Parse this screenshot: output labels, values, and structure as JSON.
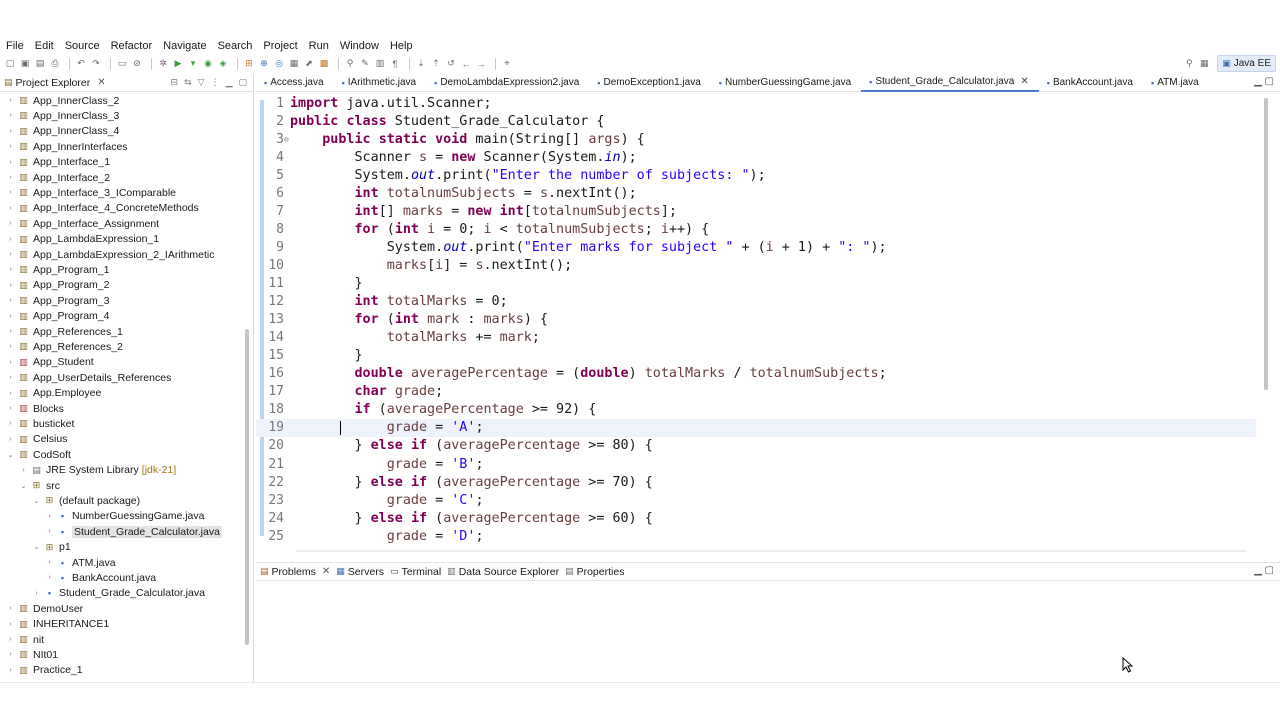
{
  "menu": [
    "File",
    "Edit",
    "Source",
    "Refactor",
    "Navigate",
    "Search",
    "Project",
    "Run",
    "Window",
    "Help"
  ],
  "perspective": {
    "label": "Java EE"
  },
  "project_explorer": {
    "title": "Project Explorer",
    "items": [
      {
        "label": "App_InnerClass_2",
        "level": 0,
        "expanded": false,
        "kind": "proj"
      },
      {
        "label": "App_InnerClass_3",
        "level": 0,
        "expanded": false,
        "kind": "proj"
      },
      {
        "label": "App_InnerClass_4",
        "level": 0,
        "expanded": false,
        "kind": "proj"
      },
      {
        "label": "App_InnerInterfaces",
        "level": 0,
        "expanded": false,
        "kind": "proj"
      },
      {
        "label": "App_Interface_1",
        "level": 0,
        "expanded": false,
        "kind": "proj"
      },
      {
        "label": "App_Interface_2",
        "level": 0,
        "expanded": false,
        "kind": "proj"
      },
      {
        "label": "App_Interface_3_IComparable",
        "level": 0,
        "expanded": false,
        "kind": "proj"
      },
      {
        "label": "App_Interface_4_ConcreteMethods",
        "level": 0,
        "expanded": false,
        "kind": "proj"
      },
      {
        "label": "App_Interface_Assignment",
        "level": 0,
        "expanded": false,
        "kind": "proj"
      },
      {
        "label": "App_LambdaExpression_1",
        "level": 0,
        "expanded": false,
        "kind": "proj"
      },
      {
        "label": "App_LambdaExpression_2_IArithmetic",
        "level": 0,
        "expanded": false,
        "kind": "proj"
      },
      {
        "label": "App_Program_1",
        "level": 0,
        "expanded": false,
        "kind": "proj"
      },
      {
        "label": "App_Program_2",
        "level": 0,
        "expanded": false,
        "kind": "proj"
      },
      {
        "label": "App_Program_3",
        "level": 0,
        "expanded": false,
        "kind": "proj"
      },
      {
        "label": "App_Program_4",
        "level": 0,
        "expanded": false,
        "kind": "proj"
      },
      {
        "label": "App_References_1",
        "level": 0,
        "expanded": false,
        "kind": "proj"
      },
      {
        "label": "App_References_2",
        "level": 0,
        "expanded": false,
        "kind": "proj"
      },
      {
        "label": "App_Student",
        "level": 0,
        "expanded": false,
        "kind": "jprj"
      },
      {
        "label": "App_UserDetails_References",
        "level": 0,
        "expanded": false,
        "kind": "proj"
      },
      {
        "label": "App.Employee",
        "level": 0,
        "expanded": false,
        "kind": "proj"
      },
      {
        "label": "Blocks",
        "level": 0,
        "expanded": false,
        "kind": "jprj"
      },
      {
        "label": "busticket",
        "level": 0,
        "expanded": false,
        "kind": "proj"
      },
      {
        "label": "Celsius",
        "level": 0,
        "expanded": false,
        "kind": "proj"
      },
      {
        "label": "CodSoft",
        "level": 0,
        "expanded": true,
        "kind": "proj"
      },
      {
        "label": "JRE System Library",
        "suffix": "[jdk-21]",
        "level": 1,
        "expanded": false,
        "kind": "lib"
      },
      {
        "label": "src",
        "level": 1,
        "expanded": true,
        "kind": "src"
      },
      {
        "label": "(default package)",
        "level": 2,
        "expanded": true,
        "kind": "pkg"
      },
      {
        "label": "NumberGuessingGame.java",
        "level": 3,
        "expanded": false,
        "kind": "java"
      },
      {
        "label": "Student_Grade_Calculator.java",
        "level": 3,
        "expanded": false,
        "kind": "java",
        "selected": true
      },
      {
        "label": "p1",
        "level": 2,
        "expanded": true,
        "kind": "pkg"
      },
      {
        "label": "ATM.java",
        "level": 3,
        "expanded": false,
        "kind": "java"
      },
      {
        "label": "BankAccount.java",
        "level": 3,
        "expanded": false,
        "kind": "java"
      },
      {
        "label": "Student_Grade_Calculator.java",
        "level": 2,
        "expanded": false,
        "kind": "java"
      },
      {
        "label": "DemoUser",
        "level": 0,
        "expanded": false,
        "kind": "proj"
      },
      {
        "label": "INHERITANCE1",
        "level": 0,
        "expanded": false,
        "kind": "proj"
      },
      {
        "label": "nit",
        "level": 0,
        "expanded": false,
        "kind": "proj"
      },
      {
        "label": "NIt01",
        "level": 0,
        "expanded": false,
        "kind": "proj"
      },
      {
        "label": "Practice_1",
        "level": 0,
        "expanded": false,
        "kind": "proj"
      }
    ]
  },
  "editor_tabs": [
    {
      "label": "Access.java",
      "active": false
    },
    {
      "label": "IArithmetic.java",
      "active": false
    },
    {
      "label": "DemoLambdaExpression2.java",
      "active": false
    },
    {
      "label": "DemoException1.java",
      "active": false
    },
    {
      "label": "NumberGuessingGame.java",
      "active": false
    },
    {
      "label": "Student_Grade_Calculator.java",
      "active": true
    },
    {
      "label": "BankAccount.java",
      "active": false
    },
    {
      "label": "ATM.java",
      "active": false
    }
  ],
  "code": {
    "current_line": 19,
    "lines": [
      [
        [
          "kw",
          "import"
        ],
        [
          "txt",
          " java.util.Scanner;"
        ]
      ],
      [
        [
          "kw",
          "public"
        ],
        [
          "txt",
          " "
        ],
        [
          "kw",
          "class"
        ],
        [
          "txt",
          " Student_Grade_Calculator {"
        ]
      ],
      [
        [
          "txt",
          "    "
        ],
        [
          "kw",
          "public"
        ],
        [
          "txt",
          " "
        ],
        [
          "kw",
          "static"
        ],
        [
          "txt",
          " "
        ],
        [
          "kw",
          "void"
        ],
        [
          "txt",
          " main(String[] "
        ],
        [
          "var",
          "args"
        ],
        [
          "txt",
          ") {"
        ]
      ],
      [
        [
          "txt",
          "        Scanner "
        ],
        [
          "var",
          "s"
        ],
        [
          "txt",
          " = "
        ],
        [
          "kw",
          "new"
        ],
        [
          "txt",
          " Scanner(System."
        ],
        [
          "fld",
          "in"
        ],
        [
          "txt",
          ");"
        ]
      ],
      [
        [
          "txt",
          "        System."
        ],
        [
          "fld",
          "out"
        ],
        [
          "txt",
          ".print("
        ],
        [
          "str",
          "\"Enter the number of subjects: \""
        ],
        [
          "txt",
          ");"
        ]
      ],
      [
        [
          "txt",
          "        "
        ],
        [
          "kw",
          "int"
        ],
        [
          "txt",
          " "
        ],
        [
          "var",
          "totalnumSubjects"
        ],
        [
          "txt",
          " = "
        ],
        [
          "var",
          "s"
        ],
        [
          "txt",
          ".nextInt();"
        ]
      ],
      [
        [
          "txt",
          "        "
        ],
        [
          "kw",
          "int"
        ],
        [
          "txt",
          "[] "
        ],
        [
          "var",
          "marks"
        ],
        [
          "txt",
          " = "
        ],
        [
          "kw",
          "new"
        ],
        [
          "txt",
          " "
        ],
        [
          "kw",
          "int"
        ],
        [
          "txt",
          "["
        ],
        [
          "var",
          "totalnumSubjects"
        ],
        [
          "txt",
          "];"
        ]
      ],
      [
        [
          "txt",
          "        "
        ],
        [
          "kw",
          "for"
        ],
        [
          "txt",
          " ("
        ],
        [
          "kw",
          "int"
        ],
        [
          "txt",
          " "
        ],
        [
          "var",
          "i"
        ],
        [
          "txt",
          " = 0; "
        ],
        [
          "var",
          "i"
        ],
        [
          "txt",
          " < "
        ],
        [
          "var",
          "totalnumSubjects"
        ],
        [
          "txt",
          "; "
        ],
        [
          "var",
          "i"
        ],
        [
          "txt",
          "++) {"
        ]
      ],
      [
        [
          "txt",
          "            System."
        ],
        [
          "fld",
          "out"
        ],
        [
          "txt",
          ".print("
        ],
        [
          "str",
          "\"Enter marks for subject \""
        ],
        [
          "txt",
          " + ("
        ],
        [
          "var",
          "i"
        ],
        [
          "txt",
          " + 1) + "
        ],
        [
          "str",
          "\": \""
        ],
        [
          "txt",
          ");"
        ]
      ],
      [
        [
          "txt",
          "            "
        ],
        [
          "var",
          "marks"
        ],
        [
          "txt",
          "["
        ],
        [
          "var",
          "i"
        ],
        [
          "txt",
          "] = "
        ],
        [
          "var",
          "s"
        ],
        [
          "txt",
          ".nextInt();"
        ]
      ],
      [
        [
          "txt",
          "        }"
        ]
      ],
      [
        [
          "txt",
          "        "
        ],
        [
          "kw",
          "int"
        ],
        [
          "txt",
          " "
        ],
        [
          "var",
          "totalMarks"
        ],
        [
          "txt",
          " = 0;"
        ]
      ],
      [
        [
          "txt",
          "        "
        ],
        [
          "kw",
          "for"
        ],
        [
          "txt",
          " ("
        ],
        [
          "kw",
          "int"
        ],
        [
          "txt",
          " "
        ],
        [
          "var",
          "mark"
        ],
        [
          "txt",
          " : "
        ],
        [
          "var",
          "marks"
        ],
        [
          "txt",
          ") {"
        ]
      ],
      [
        [
          "txt",
          "            "
        ],
        [
          "var",
          "totalMarks"
        ],
        [
          "txt",
          " += "
        ],
        [
          "var",
          "mark"
        ],
        [
          "txt",
          ";"
        ]
      ],
      [
        [
          "txt",
          "        }"
        ]
      ],
      [
        [
          "txt",
          "        "
        ],
        [
          "kw",
          "double"
        ],
        [
          "txt",
          " "
        ],
        [
          "var",
          "averagePercentage"
        ],
        [
          "txt",
          " = ("
        ],
        [
          "kw",
          "double"
        ],
        [
          "txt",
          ") "
        ],
        [
          "var",
          "totalMarks"
        ],
        [
          "txt",
          " / "
        ],
        [
          "var",
          "totalnumSubjects"
        ],
        [
          "txt",
          ";"
        ]
      ],
      [
        [
          "txt",
          "        "
        ],
        [
          "kw",
          "char"
        ],
        [
          "txt",
          " "
        ],
        [
          "var",
          "grade"
        ],
        [
          "txt",
          ";"
        ]
      ],
      [
        [
          "txt",
          "        "
        ],
        [
          "kw",
          "if"
        ],
        [
          "txt",
          " ("
        ],
        [
          "var",
          "averagePercentage"
        ],
        [
          "txt",
          " >= 92) {"
        ]
      ],
      [
        [
          "txt",
          "            "
        ],
        [
          "var",
          "grade"
        ],
        [
          "txt",
          " = "
        ],
        [
          "str",
          "'A'"
        ],
        [
          "txt",
          ";"
        ]
      ],
      [
        [
          "txt",
          "        } "
        ],
        [
          "kw",
          "else"
        ],
        [
          "txt",
          " "
        ],
        [
          "kw",
          "if"
        ],
        [
          "txt",
          " ("
        ],
        [
          "var",
          "averagePercentage"
        ],
        [
          "txt",
          " >= 80) {"
        ]
      ],
      [
        [
          "txt",
          "            "
        ],
        [
          "var",
          "grade"
        ],
        [
          "txt",
          " = "
        ],
        [
          "str",
          "'B'"
        ],
        [
          "txt",
          ";"
        ]
      ],
      [
        [
          "txt",
          "        } "
        ],
        [
          "kw",
          "else"
        ],
        [
          "txt",
          " "
        ],
        [
          "kw",
          "if"
        ],
        [
          "txt",
          " ("
        ],
        [
          "var",
          "averagePercentage"
        ],
        [
          "txt",
          " >= 70) {"
        ]
      ],
      [
        [
          "txt",
          "            "
        ],
        [
          "var",
          "grade"
        ],
        [
          "txt",
          " = "
        ],
        [
          "str",
          "'C'"
        ],
        [
          "txt",
          ";"
        ]
      ],
      [
        [
          "txt",
          "        } "
        ],
        [
          "kw",
          "else"
        ],
        [
          "txt",
          " "
        ],
        [
          "kw",
          "if"
        ],
        [
          "txt",
          " ("
        ],
        [
          "var",
          "averagePercentage"
        ],
        [
          "txt",
          " >= 60) {"
        ]
      ],
      [
        [
          "txt",
          "            "
        ],
        [
          "var",
          "grade"
        ],
        [
          "txt",
          " = "
        ],
        [
          "str",
          "'D'"
        ],
        [
          "txt",
          ";"
        ]
      ]
    ]
  },
  "bottom_tabs": [
    {
      "label": "Problems",
      "icon": "problems-icon",
      "closable": true
    },
    {
      "label": "Servers",
      "icon": "servers-icon",
      "closable": false
    },
    {
      "label": "Terminal",
      "icon": "terminal-icon",
      "closable": false
    },
    {
      "label": "Data Source Explorer",
      "icon": "data-source-icon",
      "closable": false
    },
    {
      "label": "Properties",
      "icon": "properties-icon",
      "closable": false
    }
  ],
  "colors": {
    "keyword": "#7f0055",
    "string": "#2a00ff",
    "field": "#0000c0",
    "variable": "#6a3e3e",
    "active_tab": "#4a7fcf"
  }
}
